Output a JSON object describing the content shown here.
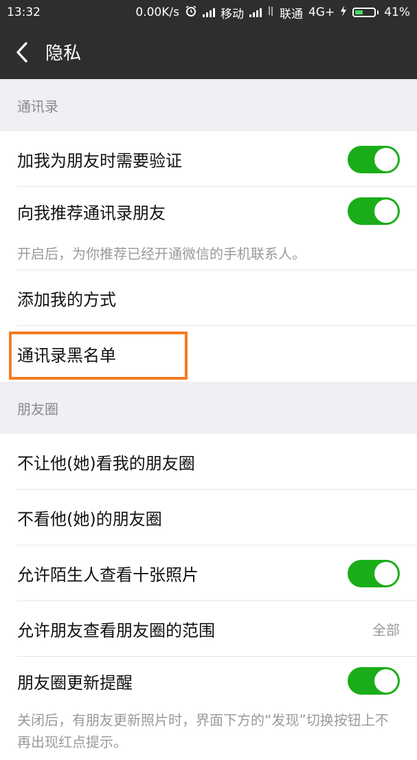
{
  "status_bar": {
    "time": "13:32",
    "speed": "0.00K/s",
    "carrier1": "移动",
    "carrier2": "联通",
    "network": "4G+",
    "battery": "41%",
    "battery_level": 0.41
  },
  "header": {
    "title": "隐私"
  },
  "contacts": {
    "section_label": "通讯录",
    "items": [
      {
        "label": "加我为朋友时需要验证",
        "toggle": true
      },
      {
        "label": "向我推荐通讯录朋友",
        "toggle": true
      }
    ],
    "hint": "开启后，为你推荐已经开通微信的手机联系人。",
    "add_method": "添加我的方式",
    "blacklist": "通讯录黑名单"
  },
  "moments": {
    "section_label": "朋友圈",
    "items": [
      {
        "label": "不让他(她)看我的朋友圈"
      },
      {
        "label": "不看他(她)的朋友圈"
      },
      {
        "label": "允许陌生人查看十张照片",
        "toggle": true
      },
      {
        "label": "允许朋友查看朋友圈的范围",
        "value": "全部"
      },
      {
        "label": "朋友圈更新提醒",
        "toggle": true
      }
    ],
    "hint": "关闭后，有朋友更新照片时，界面下方的“发现”切换按钮上不再出现红点提示。"
  },
  "colors": {
    "toggle_on": "#1aad19",
    "highlight": "#f47b22",
    "header_bg": "#2e2e2e"
  },
  "icons": [
    "back-arrow-icon",
    "alarm-icon",
    "signal-icon",
    "battery-icon"
  ]
}
